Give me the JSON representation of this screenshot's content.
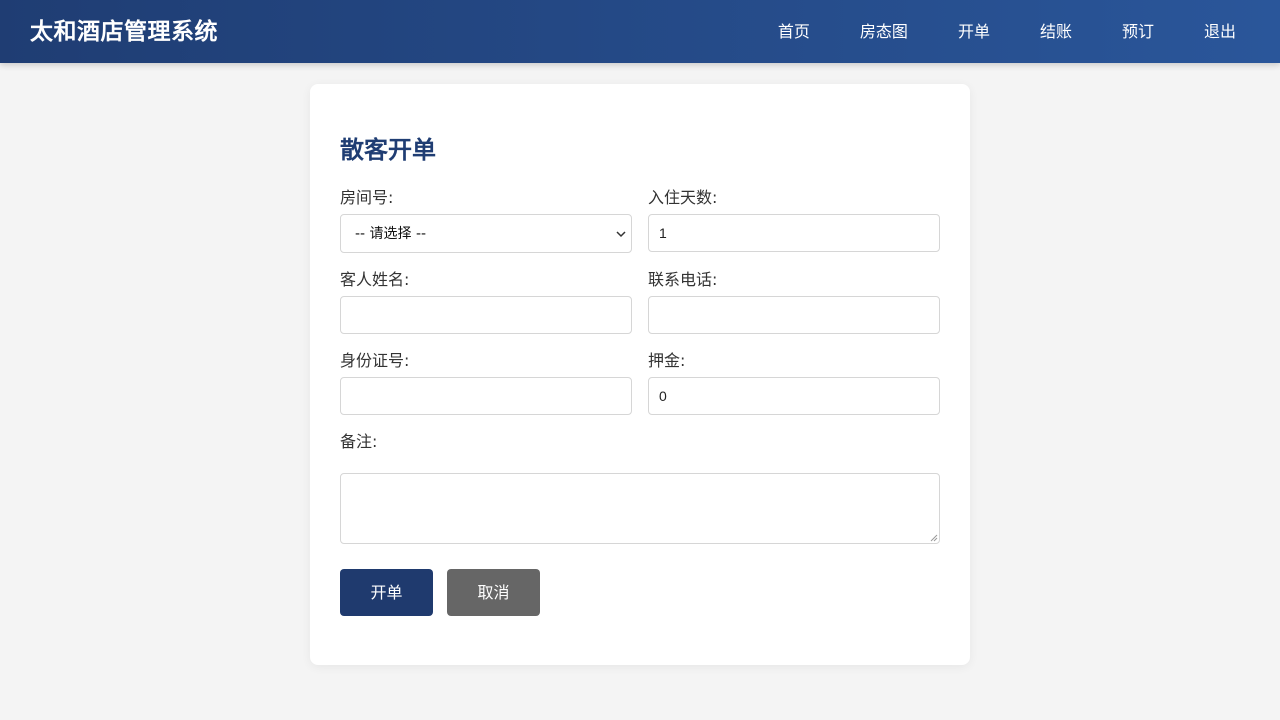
{
  "header": {
    "title": "太和酒店管理系统",
    "nav": [
      "首页",
      "房态图",
      "开单",
      "结账",
      "预订",
      "退出"
    ]
  },
  "form": {
    "title": "散客开单",
    "room_number": {
      "label": "房间号:",
      "selected": "-- 请选择 --"
    },
    "stay_days": {
      "label": "入住天数:",
      "value": "1"
    },
    "guest_name": {
      "label": "客人姓名:",
      "value": ""
    },
    "phone": {
      "label": "联系电话:",
      "value": ""
    },
    "id_number": {
      "label": "身份证号:",
      "value": ""
    },
    "deposit": {
      "label": "押金:",
      "value": "0"
    },
    "remark": {
      "label": "备注:",
      "value": ""
    },
    "submit_label": "开单",
    "cancel_label": "取消"
  },
  "colors": {
    "header_start": "#1f3d73",
    "header_end": "#2a569a",
    "title": "#1f3d73",
    "primary_button": "#1f3a6e",
    "secondary_button": "#666666",
    "background": "#f4f4f4"
  }
}
